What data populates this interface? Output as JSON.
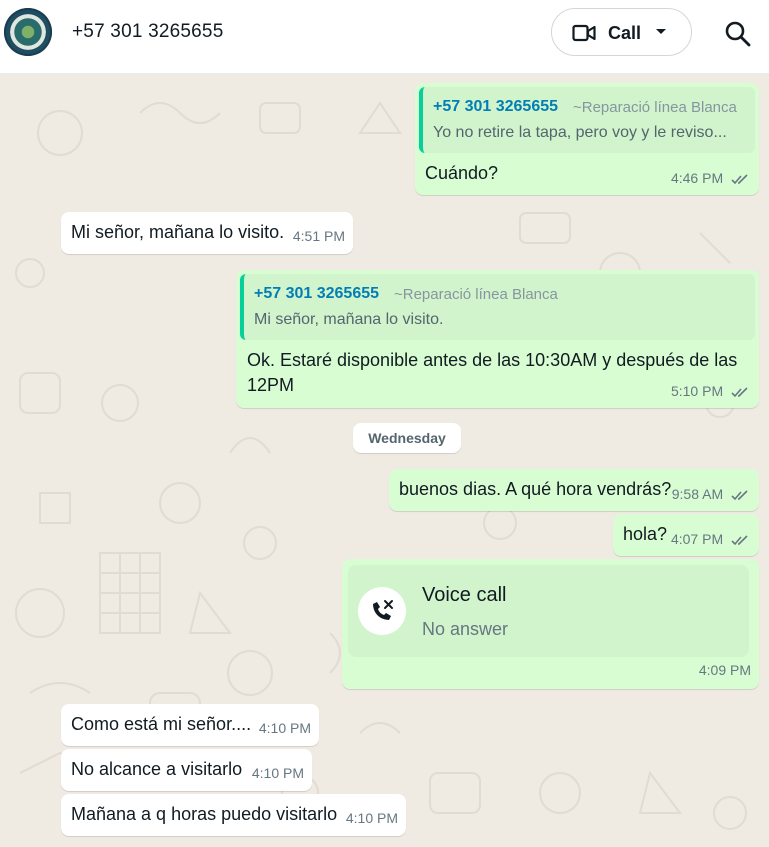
{
  "header": {
    "contact_name": "+57 301 3265655",
    "call_label": "Call",
    "icons": [
      "avatar",
      "video-camera-icon",
      "chevron-down-icon",
      "search-icon"
    ]
  },
  "messages": {
    "m1": {
      "quote_author": "+57 301 3265655",
      "quote_group": "~Reparació línea Blanca",
      "quote_text": "Yo no retire la tapa, pero voy y le reviso...",
      "text": "Cuándo?",
      "time": "4:46 PM"
    },
    "m2": {
      "text": "Mi señor, mañana lo visito.",
      "time": "4:51 PM"
    },
    "m3": {
      "quote_author": "+57 301 3265655",
      "quote_group": "~Reparació línea Blanca",
      "quote_text": "Mi señor, mañana lo visito.",
      "text_line1": "Ok. Estaré disponible antes de las 10:30AM y después de las",
      "text_line2": "12PM",
      "time": "5:10 PM"
    },
    "date_chip": "Wednesday",
    "m4": {
      "text": "buenos dias. A qué hora vendrás?",
      "time": "9:58 AM"
    },
    "m5": {
      "text": "hola?",
      "time": "4:07 PM"
    },
    "m6": {
      "call_title": "Voice call",
      "call_status": "No answer",
      "time": "4:09 PM"
    },
    "m7": {
      "text": "Como está mi señor....",
      "time": "4:10 PM"
    },
    "m8": {
      "text": "No alcance a visitarlo",
      "time": "4:10 PM"
    },
    "m9": {
      "text": "Mañana a q horas puedo visitarlo",
      "time": "4:10 PM"
    }
  },
  "colors": {
    "outgoing_bubble": "#d9fdd3",
    "incoming_bubble": "#ffffff",
    "quote_author": "#027eb5",
    "background": "#efeae2"
  }
}
